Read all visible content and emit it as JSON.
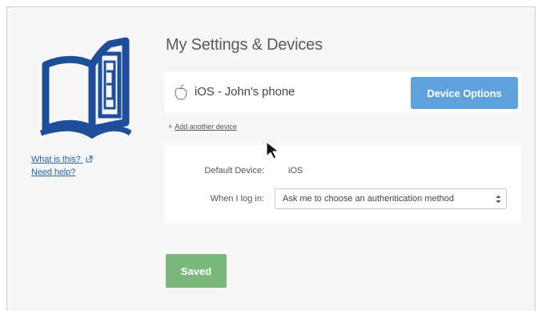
{
  "sidebar": {
    "logo_icon": "book-logo-icon",
    "links": {
      "what_is_this": "What is this?",
      "need_help": "Need help?"
    }
  },
  "main": {
    "title": "My Settings & Devices",
    "device": {
      "icon": "apple-icon",
      "name": "iOS - John's phone",
      "options_button": "Device Options"
    },
    "add_device": {
      "plus": "+",
      "label": "Add another device"
    },
    "preferences": {
      "default_device_label": "Default Device:",
      "default_device_value": "iOS",
      "login_label": "When I log in:",
      "login_selected": "Ask me to choose an authentication method"
    },
    "saved_button": "Saved"
  },
  "colors": {
    "brand_blue": "#1e4e9a",
    "link_blue": "#2464a8",
    "button_blue": "#5fa2db",
    "saved_green": "#7ab77b",
    "panel_bg": "#f7f7f7"
  }
}
